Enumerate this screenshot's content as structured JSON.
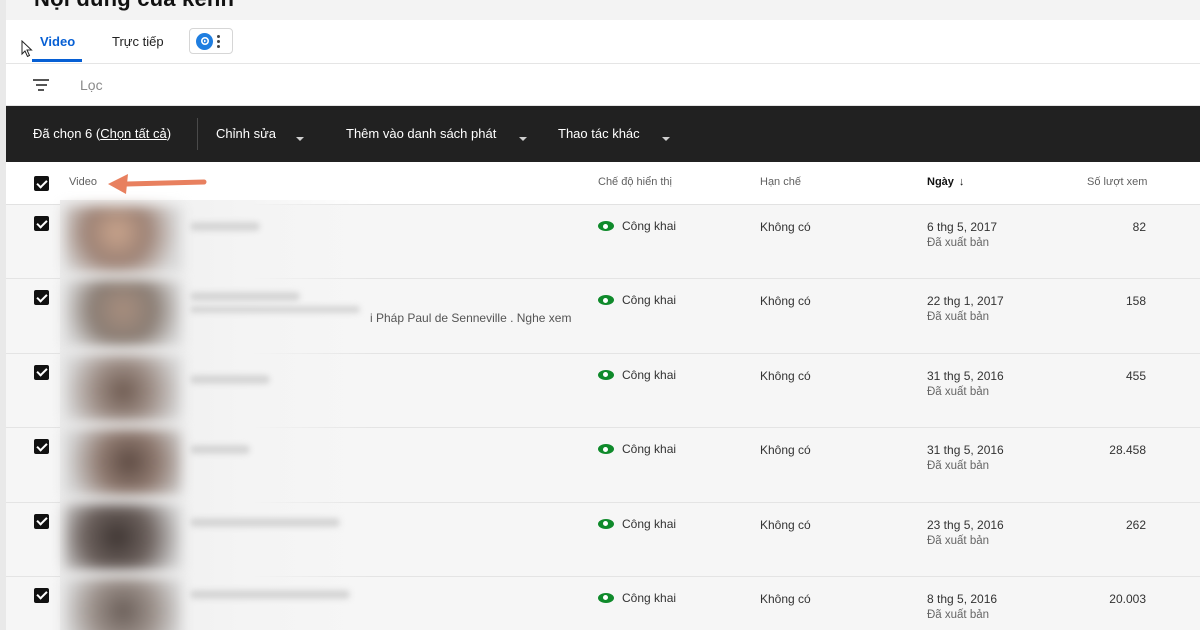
{
  "page": {
    "title": "Nội dung của kênh"
  },
  "tabs": [
    {
      "label": "Video"
    },
    {
      "label": "Trực tiếp"
    }
  ],
  "filter": {
    "placeholder": "Lọc"
  },
  "action_bar": {
    "selected_prefix": "Đã chọn 6 (",
    "select_all": "Chọn tất cả",
    "selected_suffix": ")",
    "edit": "Chỉnh sửa",
    "add_to_playlist": "Thêm vào danh sách phát",
    "more_actions": "Thao tác khác"
  },
  "table": {
    "headers": {
      "video": "Video",
      "visibility": "Chế độ hiển thị",
      "restrictions": "Hạn chế",
      "date": "Ngày",
      "views": "Số lượt xem"
    },
    "rows": [
      {
        "visibility": "Công khai",
        "restrictions": "Không có",
        "date": "6 thg 5, 2017",
        "status": "Đã xuất bản",
        "views": "82",
        "description": ""
      },
      {
        "visibility": "Công khai",
        "restrictions": "Không có",
        "date": "22 thg 1, 2017",
        "status": "Đã xuất bản",
        "views": "158",
        "description": "i Pháp Paul de Senneville . Nghe xem"
      },
      {
        "visibility": "Công khai",
        "restrictions": "Không có",
        "date": "31 thg 5, 2016",
        "status": "Đã xuất bản",
        "views": "455",
        "description": ""
      },
      {
        "visibility": "Công khai",
        "restrictions": "Không có",
        "date": "31 thg 5, 2016",
        "status": "Đã xuất bản",
        "views": "28.458",
        "description": ""
      },
      {
        "visibility": "Công khai",
        "restrictions": "Không có",
        "date": "23 thg 5, 2016",
        "status": "Đã xuất bản",
        "views": "262",
        "description": ""
      },
      {
        "visibility": "Công khai",
        "restrictions": "Không có",
        "date": "8 thg 5, 2016",
        "status": "Đã xuất bản",
        "views": "20.003",
        "description": ""
      }
    ]
  },
  "colors": {
    "accent": "#065fd4",
    "action_bar": "#212121",
    "public_eye": "#0f8a2b",
    "annotation_arrow": "#e8805f"
  },
  "icons": [
    "filter-icon",
    "shorts-icon",
    "more-vert-icon",
    "eye-icon",
    "arrow-down-icon",
    "mouse-cursor-icon",
    "annotation-arrow-icon"
  ]
}
